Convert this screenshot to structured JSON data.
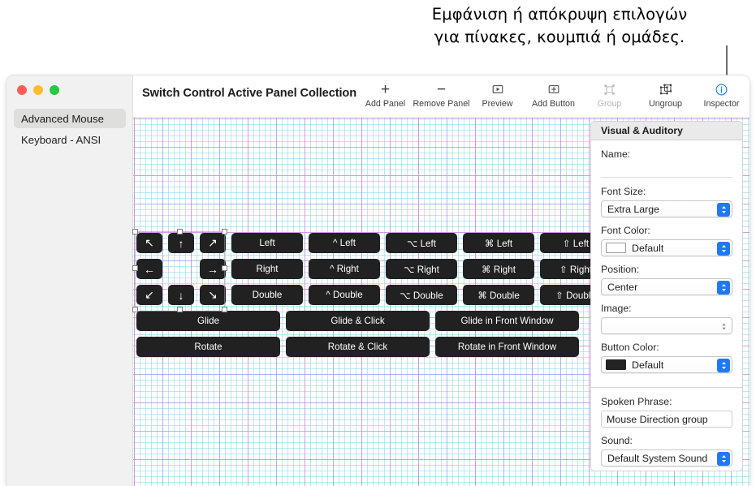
{
  "callout": {
    "line1": "Εμφάνιση ή απόκρυψη επιλογών",
    "line2": "για πίνακες, κουμπιά ή ομάδες."
  },
  "window": {
    "title": "Switch Control Active Panel Collection"
  },
  "sidebar": {
    "items": [
      {
        "label": "Advanced Mouse",
        "selected": true
      },
      {
        "label": "Keyboard - ANSI",
        "selected": false
      }
    ]
  },
  "toolbar": {
    "items": [
      {
        "label": "Add Panel",
        "icon": "plus-icon",
        "state": "enabled"
      },
      {
        "label": "Remove Panel",
        "icon": "minus-icon",
        "state": "enabled"
      },
      {
        "label": "Preview",
        "icon": "play-box-icon",
        "state": "enabled"
      },
      {
        "label": "Add Button",
        "icon": "plus-box-icon",
        "state": "enabled"
      },
      {
        "label": "Group",
        "icon": "group-icon",
        "state": "disabled"
      },
      {
        "label": "Ungroup",
        "icon": "ungroup-icon",
        "state": "enabled"
      },
      {
        "label": "Inspector",
        "icon": "info-circle-icon",
        "state": "active"
      }
    ]
  },
  "canvas": {
    "arrow_buttons": [
      [
        "↖",
        "↑",
        "↗"
      ],
      [
        "←",
        "",
        "→"
      ],
      [
        "↙",
        "↓",
        "↘"
      ]
    ],
    "action_rows": [
      [
        "Left",
        "^ Left",
        "⌥ Left",
        "⌘ Left",
        "⇧ Left"
      ],
      [
        "Right",
        "^ Right",
        "⌥ Right",
        "⌘ Right",
        "⇧ Right"
      ],
      [
        "Double",
        "^ Double",
        "⌥ Double",
        "⌘ Double",
        "⇧ Double"
      ]
    ],
    "wide_rows": [
      [
        "Glide",
        "Glide & Click",
        "Glide in Front Window"
      ],
      [
        "Rotate",
        "Rotate & Click",
        "Rotate in Front Window"
      ]
    ]
  },
  "inspector": {
    "header": "Visual & Auditory",
    "name_label": "Name:",
    "name_value": "",
    "font_size_label": "Font Size:",
    "font_size_value": "Extra Large",
    "font_color_label": "Font Color:",
    "font_color_value": "Default",
    "font_color_swatch": "#ffffff",
    "position_label": "Position:",
    "position_value": "Center",
    "image_label": "Image:",
    "image_value": "",
    "button_color_label": "Button Color:",
    "button_color_value": "Default",
    "button_color_swatch": "#232323",
    "spoken_phrase_label": "Spoken Phrase:",
    "spoken_phrase_value": "Mouse Direction group",
    "sound_label": "Sound:",
    "sound_value": "Default System Sound"
  },
  "colors": {
    "accent": "#2079f4",
    "button_fill": "#212121",
    "selected_row": "#dededd"
  }
}
